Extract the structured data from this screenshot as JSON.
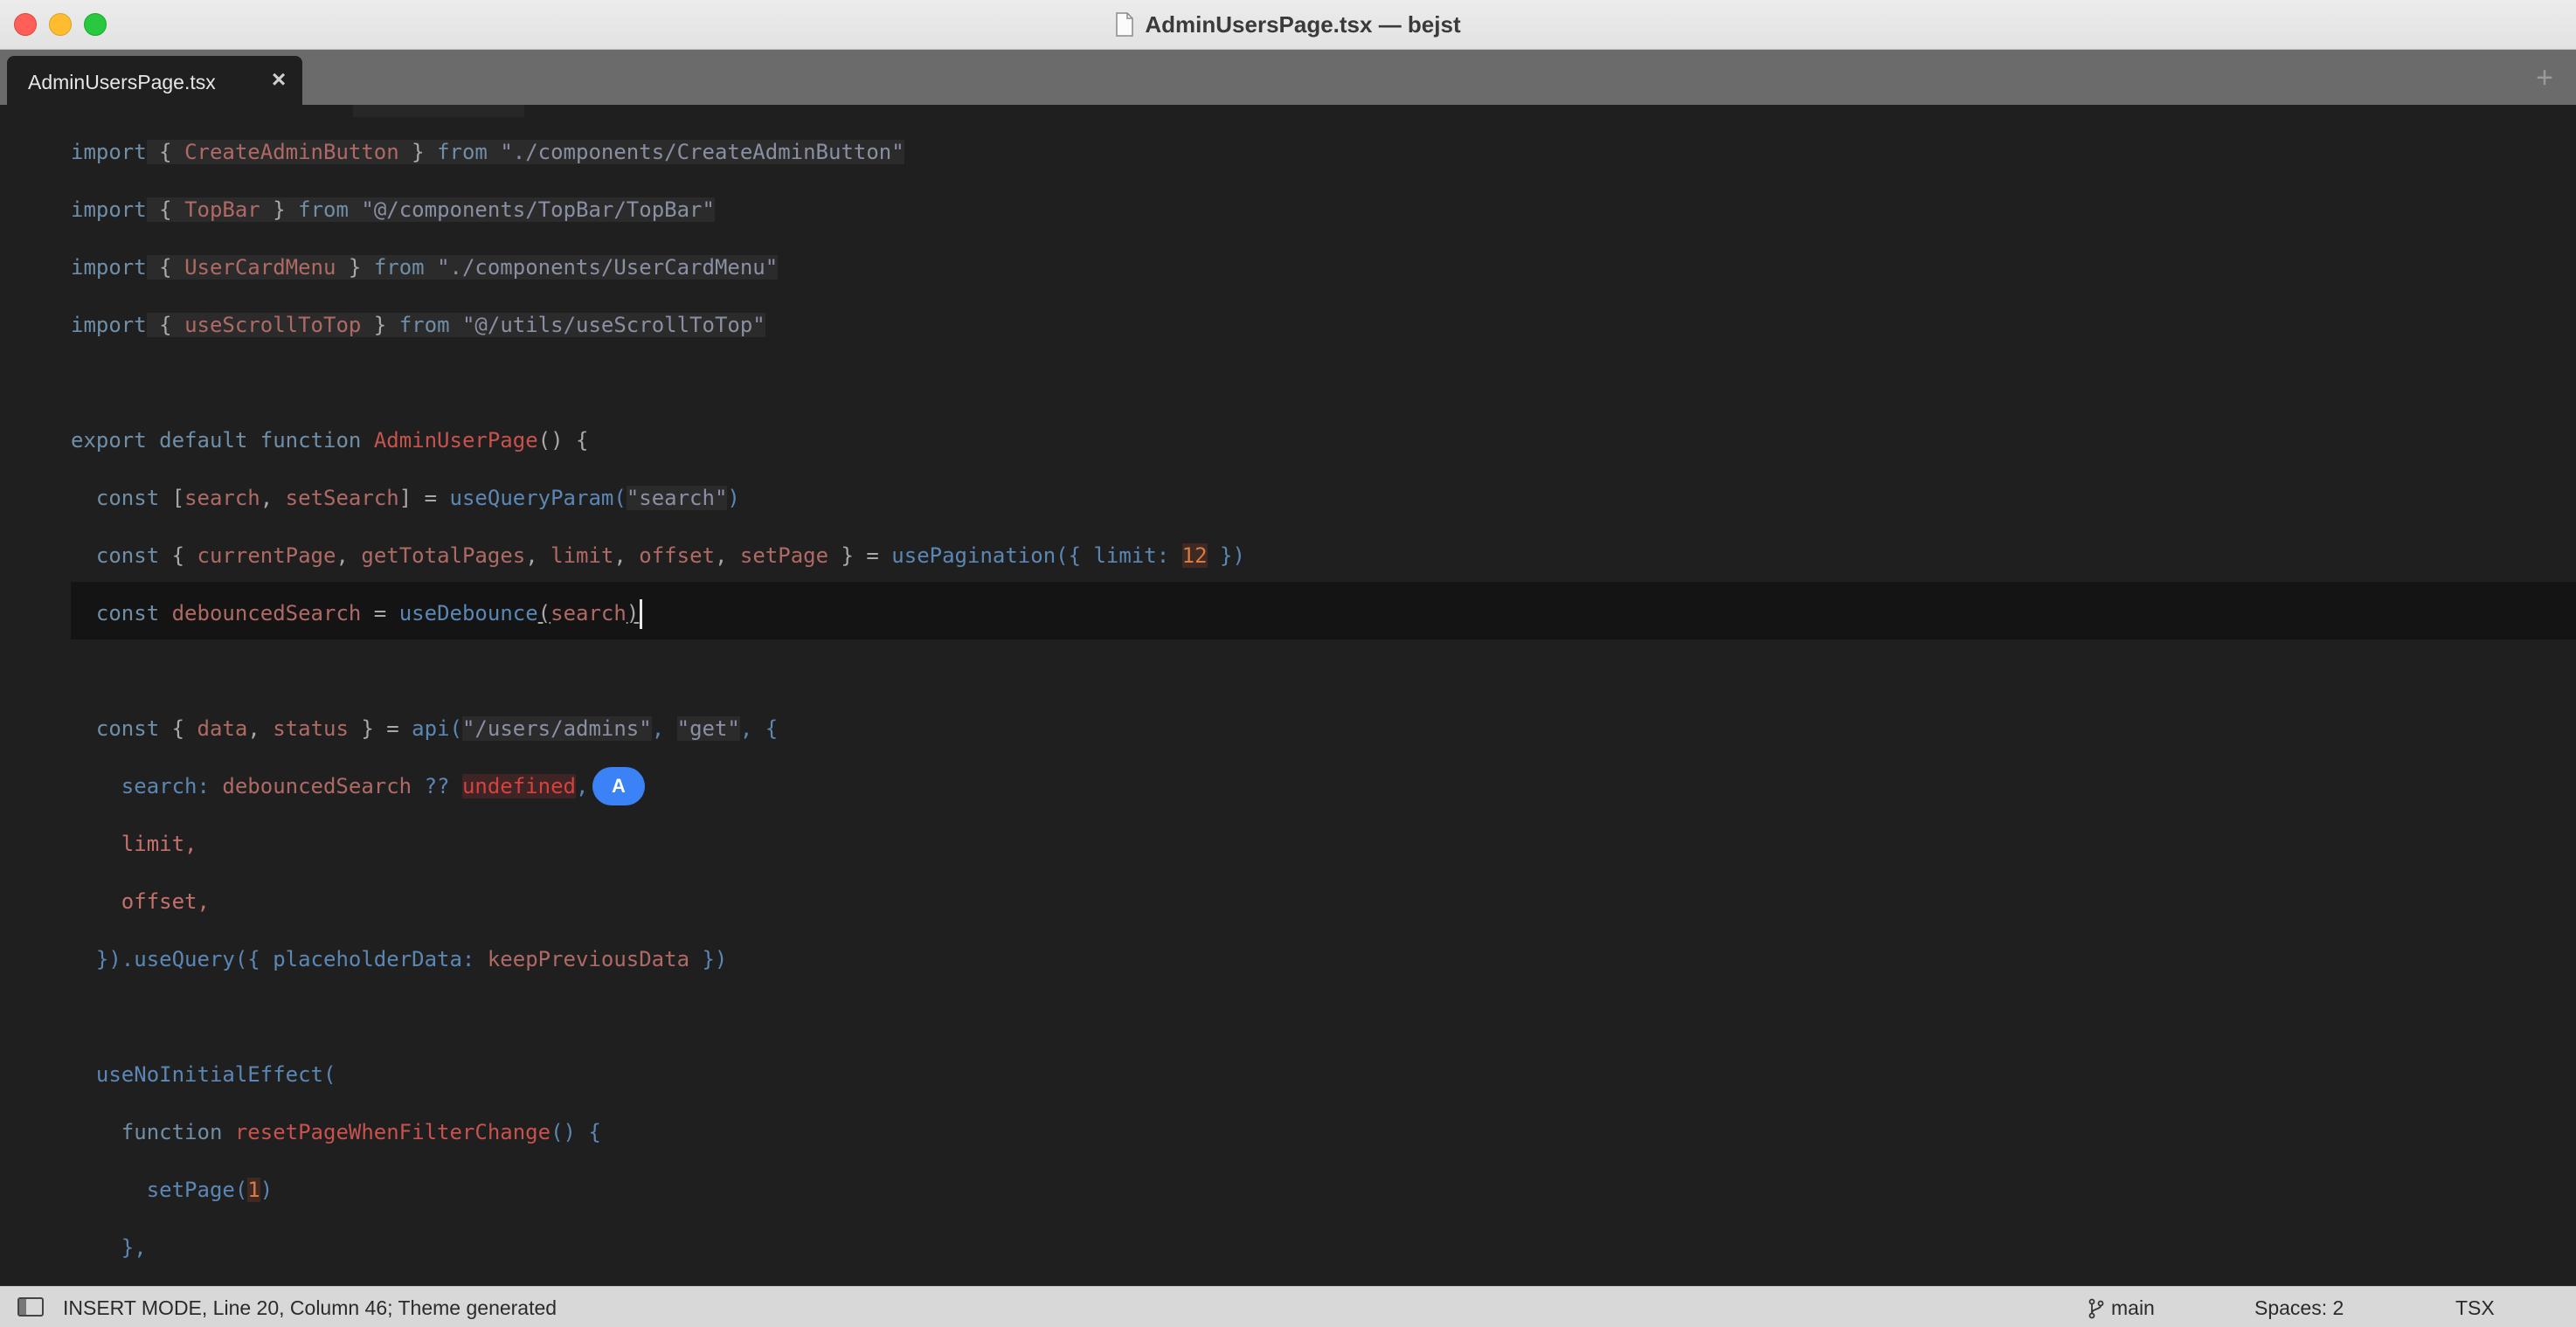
{
  "window": {
    "title": "AdminUsersPage.tsx — bejst"
  },
  "tabs": [
    {
      "label": "AdminUsersPage.tsx",
      "close": "×"
    }
  ],
  "new_tab": "+",
  "editor": {
    "cursor_badge": "A",
    "l1": {
      "a": "import",
      "b": " { ",
      "c": "CreateAdminButton",
      "d": " } ",
      "e": "from",
      "f": " ",
      "g": "\"./components/CreateAdminButton\""
    },
    "l2": {
      "a": "import",
      "b": " { ",
      "c": "TopBar",
      "d": " } ",
      "e": "from",
      "f": " ",
      "g": "\"@/components/TopBar/TopBar\""
    },
    "l3": {
      "a": "import",
      "b": " { ",
      "c": "UserCardMenu",
      "d": " } ",
      "e": "from",
      "f": " ",
      "g": "\"./components/UserCardMenu\""
    },
    "l4": {
      "a": "import",
      "b": " { ",
      "c": "useScrollToTop",
      "d": " } ",
      "e": "from",
      "f": " ",
      "g": "\"@/utils/useScrollToTop\""
    },
    "l6": {
      "a": "export",
      "b": " ",
      "c": "default",
      "d": " ",
      "e": "function",
      "f": " ",
      "g": "AdminUserPage",
      "h": "() {"
    },
    "l7": {
      "a": "  ",
      "b": "const",
      "c": " [",
      "d": "search",
      "e": ", ",
      "f": "setSearch",
      "g": "] = ",
      "h": "useQueryParam(",
      "i": "\"search\"",
      "j": ")"
    },
    "l8": {
      "a": "  ",
      "b": "const",
      "c": " { ",
      "d": "currentPage",
      "e": ", ",
      "f": "getTotalPages",
      "g": ", ",
      "h": "limit",
      "i": ", ",
      "j": "offset",
      "k": ", ",
      "l": "setPage",
      "m": " } = ",
      "n": "usePagination({ limit: ",
      "o": "12",
      "p": " })"
    },
    "l9": {
      "a": "  ",
      "b": "const",
      "c": " ",
      "d": "debouncedSearch",
      "e": " = ",
      "f": "useDebounce",
      "g": "(",
      "h": "search",
      "i": ")"
    },
    "l11": {
      "a": "  ",
      "b": "const",
      "c": " { ",
      "d": "data",
      "e": ", ",
      "f": "status",
      "g": " } = ",
      "h": "api(",
      "i": "\"/users/admins\"",
      "j": ", ",
      "k": "\"get\"",
      "l": ", {"
    },
    "l12": {
      "a": "    ",
      "b": "search: ",
      "c": "debouncedSearch",
      "d": " ?? ",
      "e": "undefined",
      "f": ","
    },
    "l13": {
      "a": "    ",
      "b": "limit,",
      "c": ""
    },
    "l14": {
      "a": "    ",
      "b": "offset,",
      "c": ""
    },
    "l15": {
      "a": "  ",
      "b": "}).useQuery({ placeholderData: ",
      "c": "keepPreviousData",
      "d": " })"
    },
    "l17": {
      "a": "  ",
      "b": "useNoInitialEffect("
    },
    "l18": {
      "a": "    ",
      "b": "function",
      "c": " ",
      "d": "resetPageWhenFilterChange",
      "e": "() {"
    },
    "l19": {
      "a": "      ",
      "b": "setPage(",
      "c": "1",
      "d": ")"
    },
    "l20": {
      "a": "    ",
      "b": "},"
    }
  },
  "status": {
    "mode": "INSERT MODE, Line 20, Column 46; Theme generated",
    "branch": "main",
    "spaces": "Spaces: 2",
    "syntax": "TSX"
  },
  "colors": {
    "keyword": "#6f8ea8",
    "identifier": "#b06a66",
    "type": "#c8524d",
    "function": "#5b87b5",
    "number": "#d97b45",
    "badge": "#3b82f6"
  }
}
